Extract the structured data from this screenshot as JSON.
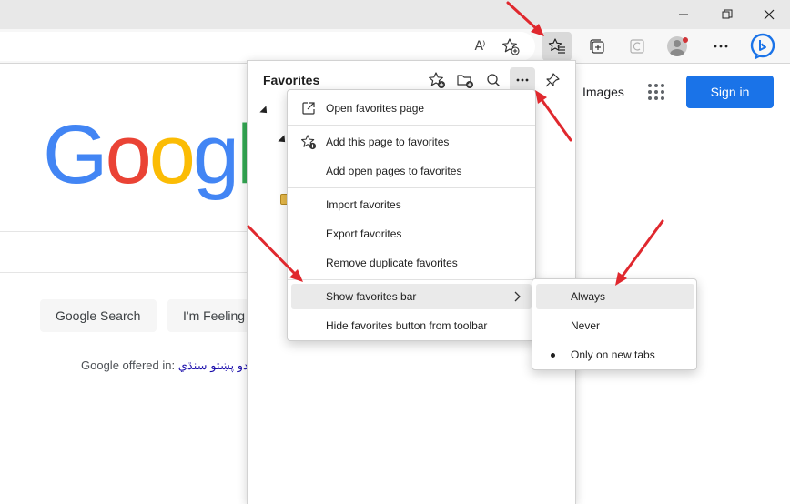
{
  "browser": {
    "accent_color": "#1a73e8",
    "annotation_color": "#e0282e",
    "toolbar_icons": [
      "read-aloud-icon",
      "add-favorite-icon",
      "favorites-icon",
      "collections-icon",
      "browser-essentials-icon",
      "profile-avatar",
      "more-icon",
      "bing-chat-icon"
    ],
    "read_aloud_label": "A⁾"
  },
  "google": {
    "logo_letters": [
      "G",
      "o",
      "o",
      "g",
      "l"
    ],
    "logo_colors": [
      "#4285f4",
      "#ea4335",
      "#fbbc05",
      "#4285f4",
      "#34a853"
    ],
    "images_link": "Images",
    "sign_in": "Sign in",
    "search_button": "Google Search",
    "lucky_button": "I'm Feeling",
    "offered_in": "Google offered in:",
    "languages": [
      "اردو",
      "پښتو",
      "سنڌي"
    ]
  },
  "favorites_pane": {
    "title": "Favorites",
    "header_icons": [
      "add-favorite-icon",
      "add-folder-icon",
      "search-icon",
      "more-options-icon",
      "pin-icon"
    ]
  },
  "menu": {
    "items": [
      {
        "label": "Open favorites page",
        "icon": "open-external-icon"
      },
      {
        "label": "Add this page to favorites",
        "icon": "star-add-icon"
      },
      {
        "label": "Add open pages to favorites",
        "icon": ""
      },
      {
        "label": "Import favorites",
        "icon": ""
      },
      {
        "label": "Export favorites",
        "icon": ""
      },
      {
        "label": "Remove duplicate favorites",
        "icon": ""
      },
      {
        "label": "Show favorites bar",
        "icon": "",
        "submenu": true
      },
      {
        "label": "Hide favorites button from toolbar",
        "icon": ""
      }
    ]
  },
  "submenu": {
    "items": [
      {
        "label": "Always",
        "selected": false
      },
      {
        "label": "Never",
        "selected": false
      },
      {
        "label": "Only on new tabs",
        "selected": true
      }
    ]
  }
}
